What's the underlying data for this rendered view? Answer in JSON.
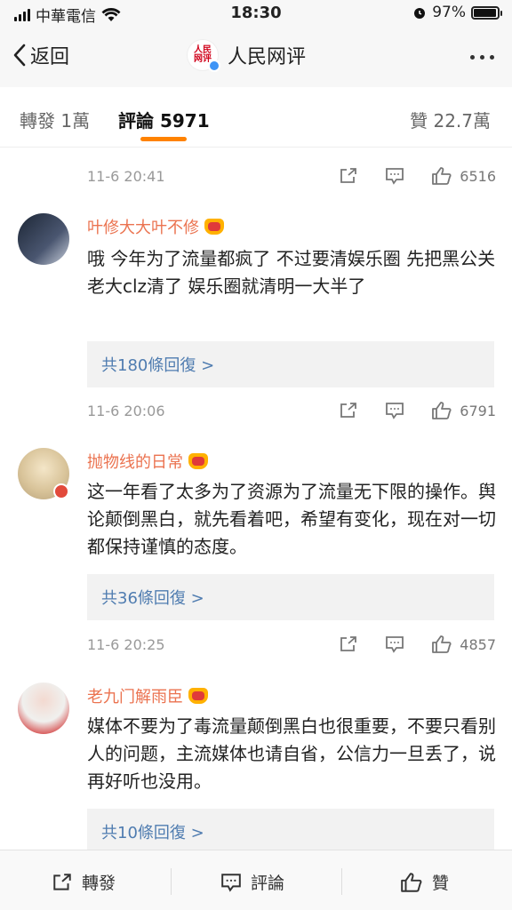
{
  "status_bar": {
    "carrier": "中華電信",
    "time": "18:30",
    "battery_percent": "97%",
    "battery_level": 0.97,
    "icons": [
      "signal-icon",
      "wifi-icon",
      "alarm-icon",
      "battery-icon"
    ]
  },
  "nav": {
    "back_label": "返回",
    "title": "人民网评",
    "logo_text": "人民网评"
  },
  "tabs": {
    "repost": "轉發 1萬",
    "comments": "評論 5971",
    "likes": "贊 22.7萬"
  },
  "top_meta": {
    "time": "11-6 20:41",
    "likes": "6516"
  },
  "comments": [
    {
      "username": "叶修大大叶不修",
      "text": "哦 今年为了流量都疯了 不过要清娱乐圈 先把黑公关老大clz清了 娱乐圈就清明一大半了",
      "replies": "共180條回復 >",
      "time": "11-6 20:06",
      "likes": "6791"
    },
    {
      "username": "抛物线的日常",
      "text": "这一年看了太多为了资源为了流量无下限的操作。舆论颠倒黑白，就先看着吧，希望有变化，现在对一切都保持谨慎的态度。",
      "replies": "共36條回復 >",
      "time": "11-6 20:25",
      "likes": "4857"
    },
    {
      "username": "老九门解雨臣",
      "text": "媒体不要为了毒流量颠倒黑白也很重要，不要只看别人的问题，主流媒体也请自省，公信力一旦丢了，说再好听也没用。",
      "replies": "共10條回復 >"
    }
  ],
  "bottom_bar": {
    "repost": "轉發",
    "comment": "評論",
    "like": "贊"
  },
  "colors": {
    "accent": "#ff8200",
    "username": "#eb7350",
    "link": "#4f7cb0"
  }
}
